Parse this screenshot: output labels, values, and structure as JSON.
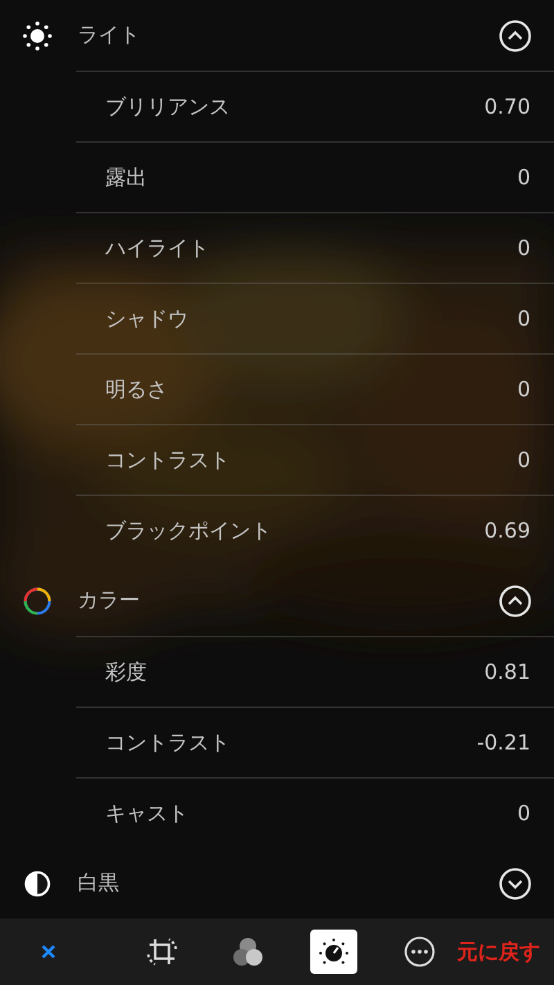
{
  "sections": [
    {
      "kind": "light",
      "title": "ライト",
      "expanded": true,
      "items": [
        {
          "label": "ブリリアンス",
          "value": "0.70"
        },
        {
          "label": "露出",
          "value": "0"
        },
        {
          "label": "ハイライト",
          "value": "0"
        },
        {
          "label": "シャドウ",
          "value": "0"
        },
        {
          "label": "明るさ",
          "value": "0"
        },
        {
          "label": "コントラスト",
          "value": "0"
        },
        {
          "label": "ブラックポイント",
          "value": "0.69"
        }
      ]
    },
    {
      "kind": "color",
      "title": "カラー",
      "expanded": true,
      "items": [
        {
          "label": "彩度",
          "value": "0.81"
        },
        {
          "label": "コントラスト",
          "value": "-0.21"
        },
        {
          "label": "キャスト",
          "value": "0"
        }
      ]
    },
    {
      "kind": "bw",
      "title": "白黒",
      "expanded": false
    }
  ],
  "toolbar": {
    "tools": [
      {
        "kind": "crop",
        "selected": false
      },
      {
        "kind": "filters",
        "selected": false
      },
      {
        "kind": "adjust",
        "selected": true
      },
      {
        "kind": "more",
        "selected": false
      }
    ],
    "revert": "元に戻す"
  }
}
